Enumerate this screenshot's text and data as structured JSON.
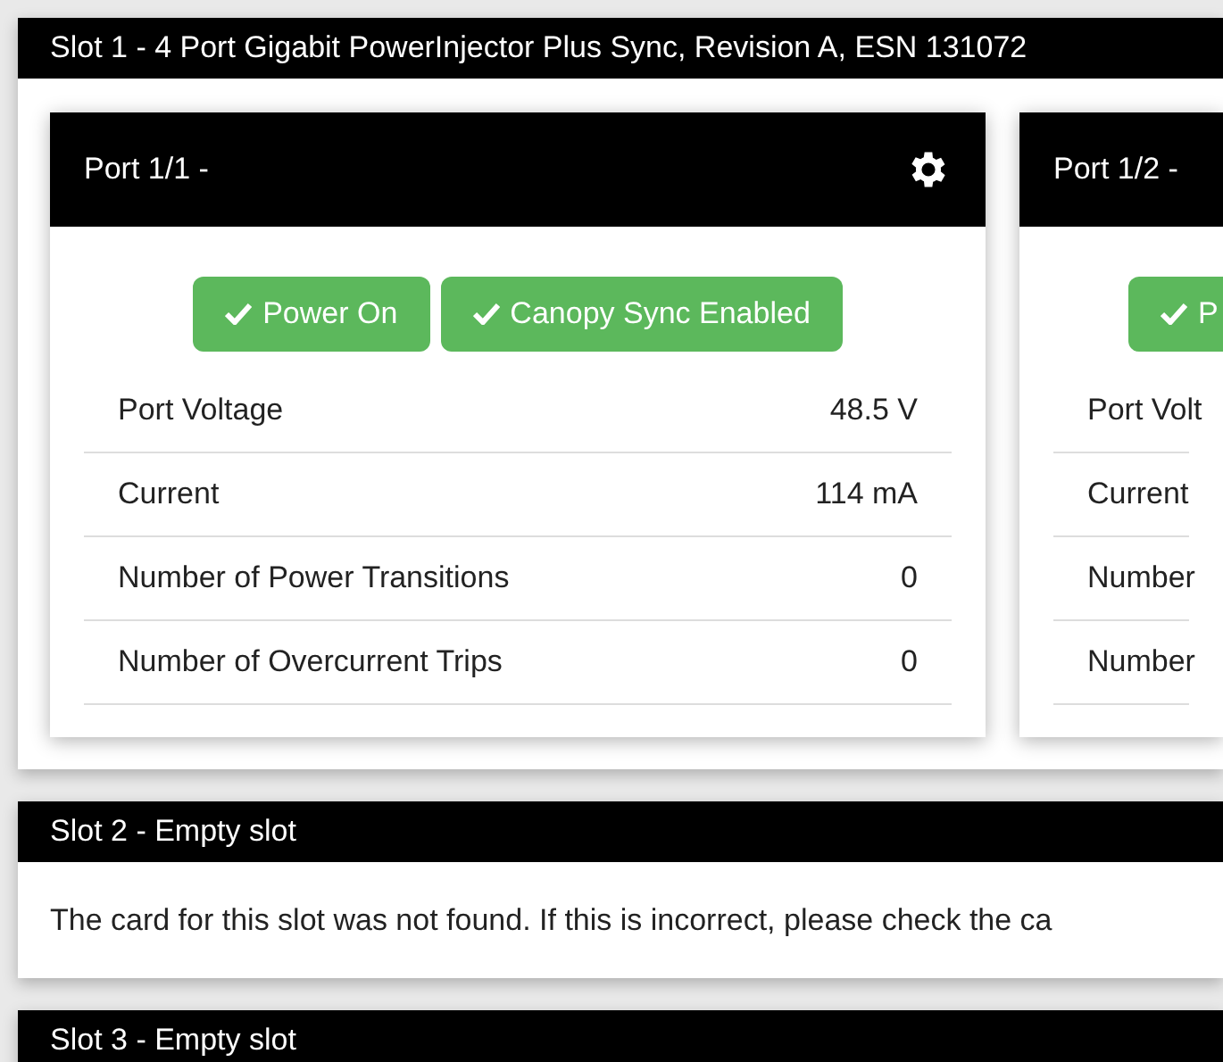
{
  "slots": [
    {
      "title": "Slot 1 - 4 Port Gigabit PowerInjector Plus Sync, Revision A, ESN 131072",
      "kind": "ports",
      "ports": [
        {
          "title": "Port 1/1 -",
          "settings": true,
          "buttons": [
            {
              "label": "Power On",
              "enabled": true
            },
            {
              "label": "Canopy Sync Enabled",
              "enabled": true
            }
          ],
          "rows": [
            {
              "label": "Port Voltage",
              "value": "48.5 V"
            },
            {
              "label": "Current",
              "value": "114 mA"
            },
            {
              "label": "Number of Power Transitions",
              "value": "0"
            },
            {
              "label": "Number of Overcurrent Trips",
              "value": "0"
            }
          ]
        },
        {
          "title": "Port 1/2 -",
          "settings": false,
          "buttons": [
            {
              "label": "P",
              "enabled": true
            }
          ],
          "rows": [
            {
              "label": "Port Volt"
            },
            {
              "label": "Current"
            },
            {
              "label": "Number"
            },
            {
              "label": "Number"
            }
          ]
        }
      ]
    },
    {
      "title": "Slot 2 - Empty slot",
      "kind": "empty",
      "message": "The card for this slot was not found. If this is incorrect, please check the ca"
    },
    {
      "title": "Slot 3 - Empty slot",
      "kind": "empty"
    }
  ]
}
